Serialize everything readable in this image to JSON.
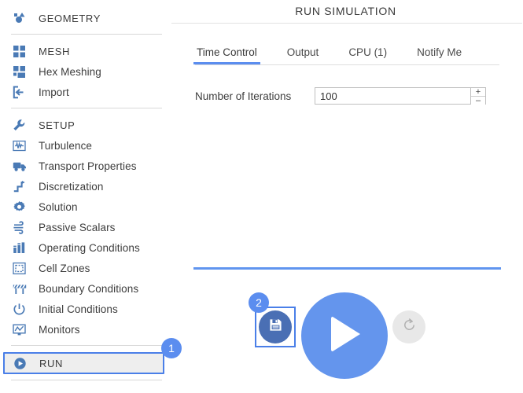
{
  "sidebar": {
    "groups": [
      {
        "items": [
          {
            "label": "GEOMETRY",
            "icon": "geometry-icon",
            "name": "geometry",
            "header": true,
            "selected": false
          }
        ]
      },
      {
        "items": [
          {
            "label": "MESH",
            "icon": "mesh-icon",
            "name": "mesh",
            "header": true,
            "selected": false
          },
          {
            "label": "Hex Meshing",
            "icon": "hex-meshing-icon",
            "name": "hex-meshing",
            "header": false,
            "selected": false
          },
          {
            "label": "Import",
            "icon": "import-icon",
            "name": "import",
            "header": false,
            "selected": false
          }
        ]
      },
      {
        "items": [
          {
            "label": "SETUP",
            "icon": "wrench-icon",
            "name": "setup",
            "header": true,
            "selected": false
          },
          {
            "label": "Turbulence",
            "icon": "turbulence-icon",
            "name": "turbulence",
            "header": false,
            "selected": false
          },
          {
            "label": "Transport Properties",
            "icon": "truck-icon",
            "name": "transport-properties",
            "header": false,
            "selected": false
          },
          {
            "label": "Discretization",
            "icon": "discretization-icon",
            "name": "discretization",
            "header": false,
            "selected": false
          },
          {
            "label": "Solution",
            "icon": "gear-icon",
            "name": "solution",
            "header": false,
            "selected": false
          },
          {
            "label": "Passive Scalars",
            "icon": "wind-icon",
            "name": "passive-scalars",
            "header": false,
            "selected": false
          },
          {
            "label": "Operating Conditions",
            "icon": "bar-chart-icon",
            "name": "operating-conditions",
            "header": false,
            "selected": false
          },
          {
            "label": "Cell Zones",
            "icon": "cell-zones-icon",
            "name": "cell-zones",
            "header": false,
            "selected": false
          },
          {
            "label": "Boundary Conditions",
            "icon": "boundary-icon",
            "name": "boundary-conditions",
            "header": false,
            "selected": false
          },
          {
            "label": "Initial Conditions",
            "icon": "power-icon",
            "name": "initial-conditions",
            "header": false,
            "selected": false
          },
          {
            "label": "Monitors",
            "icon": "monitor-icon",
            "name": "monitors",
            "header": false,
            "selected": false
          }
        ]
      },
      {
        "items": [
          {
            "label": "RUN",
            "icon": "play-circle-icon",
            "name": "run",
            "header": true,
            "selected": true
          }
        ]
      }
    ]
  },
  "main": {
    "title": "RUN SIMULATION",
    "tabs": [
      {
        "label": "Time Control",
        "name": "tab-time-control",
        "active": true
      },
      {
        "label": "Output",
        "name": "tab-output",
        "active": false
      },
      {
        "label": "CPU  (1)",
        "name": "tab-cpu",
        "active": false
      },
      {
        "label": "Notify Me",
        "name": "tab-notify-me",
        "active": false
      }
    ],
    "iterations": {
      "label": "Number of Iterations",
      "value": "100",
      "placeholder": "100",
      "increment_label": "+",
      "decrement_label": "–"
    },
    "actions": {
      "save_name": "save-button",
      "play_name": "play-button",
      "reset_name": "reset-button"
    }
  },
  "badges": [
    {
      "label": "1",
      "name": "step-badge-1"
    },
    {
      "label": "2",
      "name": "step-badge-2"
    }
  ],
  "colors": {
    "accent_blue": "#5b8def",
    "play_blue": "#6495ed",
    "save_blue": "#4a6fb4",
    "icon_blue": "#4a7ab5",
    "reset_grey": "#e8e8e8",
    "selected_bg": "#eeeeee"
  }
}
